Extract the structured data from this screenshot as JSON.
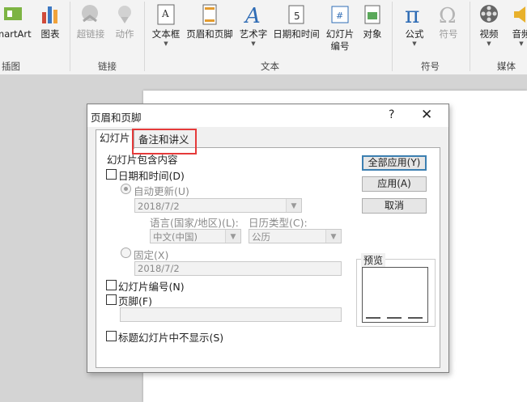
{
  "ribbon": {
    "buttons": [
      {
        "label": "martArt"
      },
      {
        "label": "图表"
      },
      {
        "label": "超链接"
      },
      {
        "label": "动作"
      },
      {
        "label": "文本框"
      },
      {
        "label": "页眉和页脚"
      },
      {
        "label": "艺术字"
      },
      {
        "label": "日期和时间"
      },
      {
        "label": "幻灯片\n编号"
      },
      {
        "label": "对象"
      },
      {
        "label": "公式"
      },
      {
        "label": "符号"
      },
      {
        "label": "视频"
      },
      {
        "label": "音频"
      }
    ],
    "groups": {
      "illustrations": "插图",
      "links": "链接",
      "text": "文本",
      "symbols": "符号",
      "media": "媒体"
    }
  },
  "dialog": {
    "title": "页眉和页脚",
    "help": "?",
    "close": "✕",
    "tabs": [
      {
        "label": "幻灯片",
        "active": true
      },
      {
        "label": "备注和讲义",
        "active": false
      }
    ],
    "section_title": "幻灯片包含内容",
    "date_time": {
      "label": "日期和时间(D)",
      "checked": false,
      "auto_update": {
        "label": "自动更新(U)",
        "selected": true,
        "value": "2018/7/2"
      },
      "language": {
        "label": "语言(国家/地区)(L):",
        "value": "中文(中国)"
      },
      "calendar": {
        "label": "日历类型(C):",
        "value": "公历"
      },
      "fixed": {
        "label": "固定(X)",
        "selected": false,
        "value": "2018/7/2"
      }
    },
    "slide_number": {
      "label": "幻灯片编号(N)",
      "checked": false
    },
    "footer": {
      "label": "页脚(F)",
      "checked": false,
      "value": ""
    },
    "dont_show_title": {
      "label": "标题幻灯片中不显示(S)",
      "checked": false
    },
    "buttons": {
      "apply_all": "全部应用(Y)",
      "apply": "应用(A)",
      "cancel": "取消"
    },
    "preview": {
      "label": "预览"
    }
  },
  "colors": {
    "highlight": "#e53a3a",
    "default_button_border": "#3c7fb1"
  }
}
